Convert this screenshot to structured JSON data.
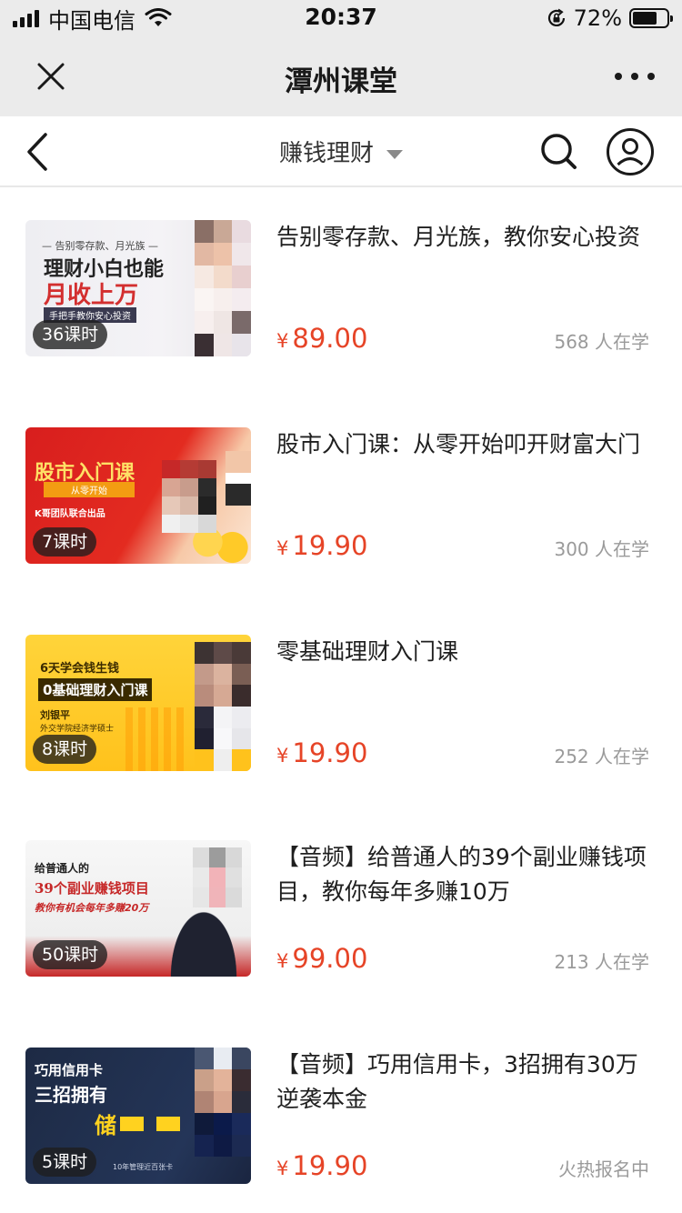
{
  "status_bar": {
    "carrier": "中国电信",
    "time": "20:37",
    "battery": "72%",
    "battery_level": 0.72
  },
  "title_bar": {
    "title": "潭州课堂"
  },
  "nav": {
    "category": "赚钱理财"
  },
  "courses": [
    {
      "title": "告别零存款、月光族，教你安心投资",
      "currency": "¥",
      "price": "89.00",
      "learners": "568 人在学",
      "lessons": "36课时",
      "thumb": {
        "line1": "— 告别零存款、月光族 —",
        "line2": "理财小白也能",
        "line3": "月收上万",
        "line4": "手把手教你安心投资"
      }
    },
    {
      "title": "股市入门课：从零开始叩开财富大门",
      "currency": "¥",
      "price": "19.90",
      "learners": "300 人在学",
      "lessons": "7课时",
      "thumb": {
        "line1": "股市入门课",
        "line2": "从零开始",
        "line3": "K哥团队联合出品"
      }
    },
    {
      "title": "零基础理财入门课",
      "currency": "¥",
      "price": "19.90",
      "learners": "252 人在学",
      "lessons": "8课时",
      "thumb": {
        "line1": "6天学会钱生钱",
        "line2": "0基础理财入门课",
        "line3": "刘银平",
        "line4": "外交学院经济学硕士"
      }
    },
    {
      "title": "【音频】给普通人的39个副业赚钱项目，教你每年多赚10万",
      "currency": "¥",
      "price": "99.00",
      "learners": "213 人在学",
      "lessons": "50课时",
      "thumb": {
        "line1": "给普通人的",
        "line2": "39个副业赚钱项目",
        "line3": "教你有机会每年多赚20万"
      }
    },
    {
      "title": "【音频】巧用信用卡，3招拥有30万逆袭本金",
      "currency": "¥",
      "price": "19.90",
      "learners": "火热报名中",
      "lessons": "5课时",
      "thumb": {
        "line1": "巧用信用卡",
        "line2": "三招拥有",
        "line3": "储",
        "line4": "10年管理近百张卡"
      }
    }
  ],
  "colors": {
    "price": "#e64427",
    "bar_bg": "#ebebeb",
    "muted": "#9a9a9a"
  },
  "icons": [
    "signal-icon",
    "wifi-icon",
    "rotation-lock-icon",
    "battery-icon",
    "close-icon",
    "more-icon",
    "back-icon",
    "dropdown-caret-icon",
    "search-icon",
    "user-icon"
  ]
}
